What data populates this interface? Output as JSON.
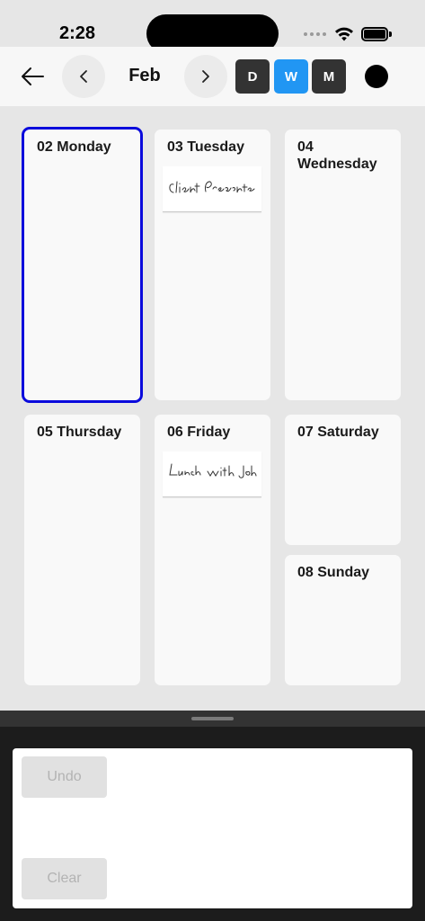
{
  "status_bar": {
    "time": "2:28"
  },
  "header": {
    "month": "Feb",
    "views": [
      {
        "label": "D",
        "active": false
      },
      {
        "label": "W",
        "active": true
      },
      {
        "label": "M",
        "active": false
      }
    ],
    "pen_color": "#000000",
    "accent_color": "#2196f3"
  },
  "week": {
    "selected_day": "02 Monday",
    "days": [
      {
        "title": "02 Monday",
        "note": null
      },
      {
        "title": "03 Tuesday",
        "note": "Client Presentation"
      },
      {
        "title": "04 Wednesday",
        "note": null
      },
      {
        "title": "05 Thursday",
        "note": null
      },
      {
        "title": "06 Friday",
        "note": "Lunch with John"
      },
      {
        "title": "07 Saturday",
        "note": null
      },
      {
        "title": "08 Sunday",
        "note": null
      }
    ]
  },
  "drawing_panel": {
    "undo_label": "Undo",
    "clear_label": "Clear"
  }
}
